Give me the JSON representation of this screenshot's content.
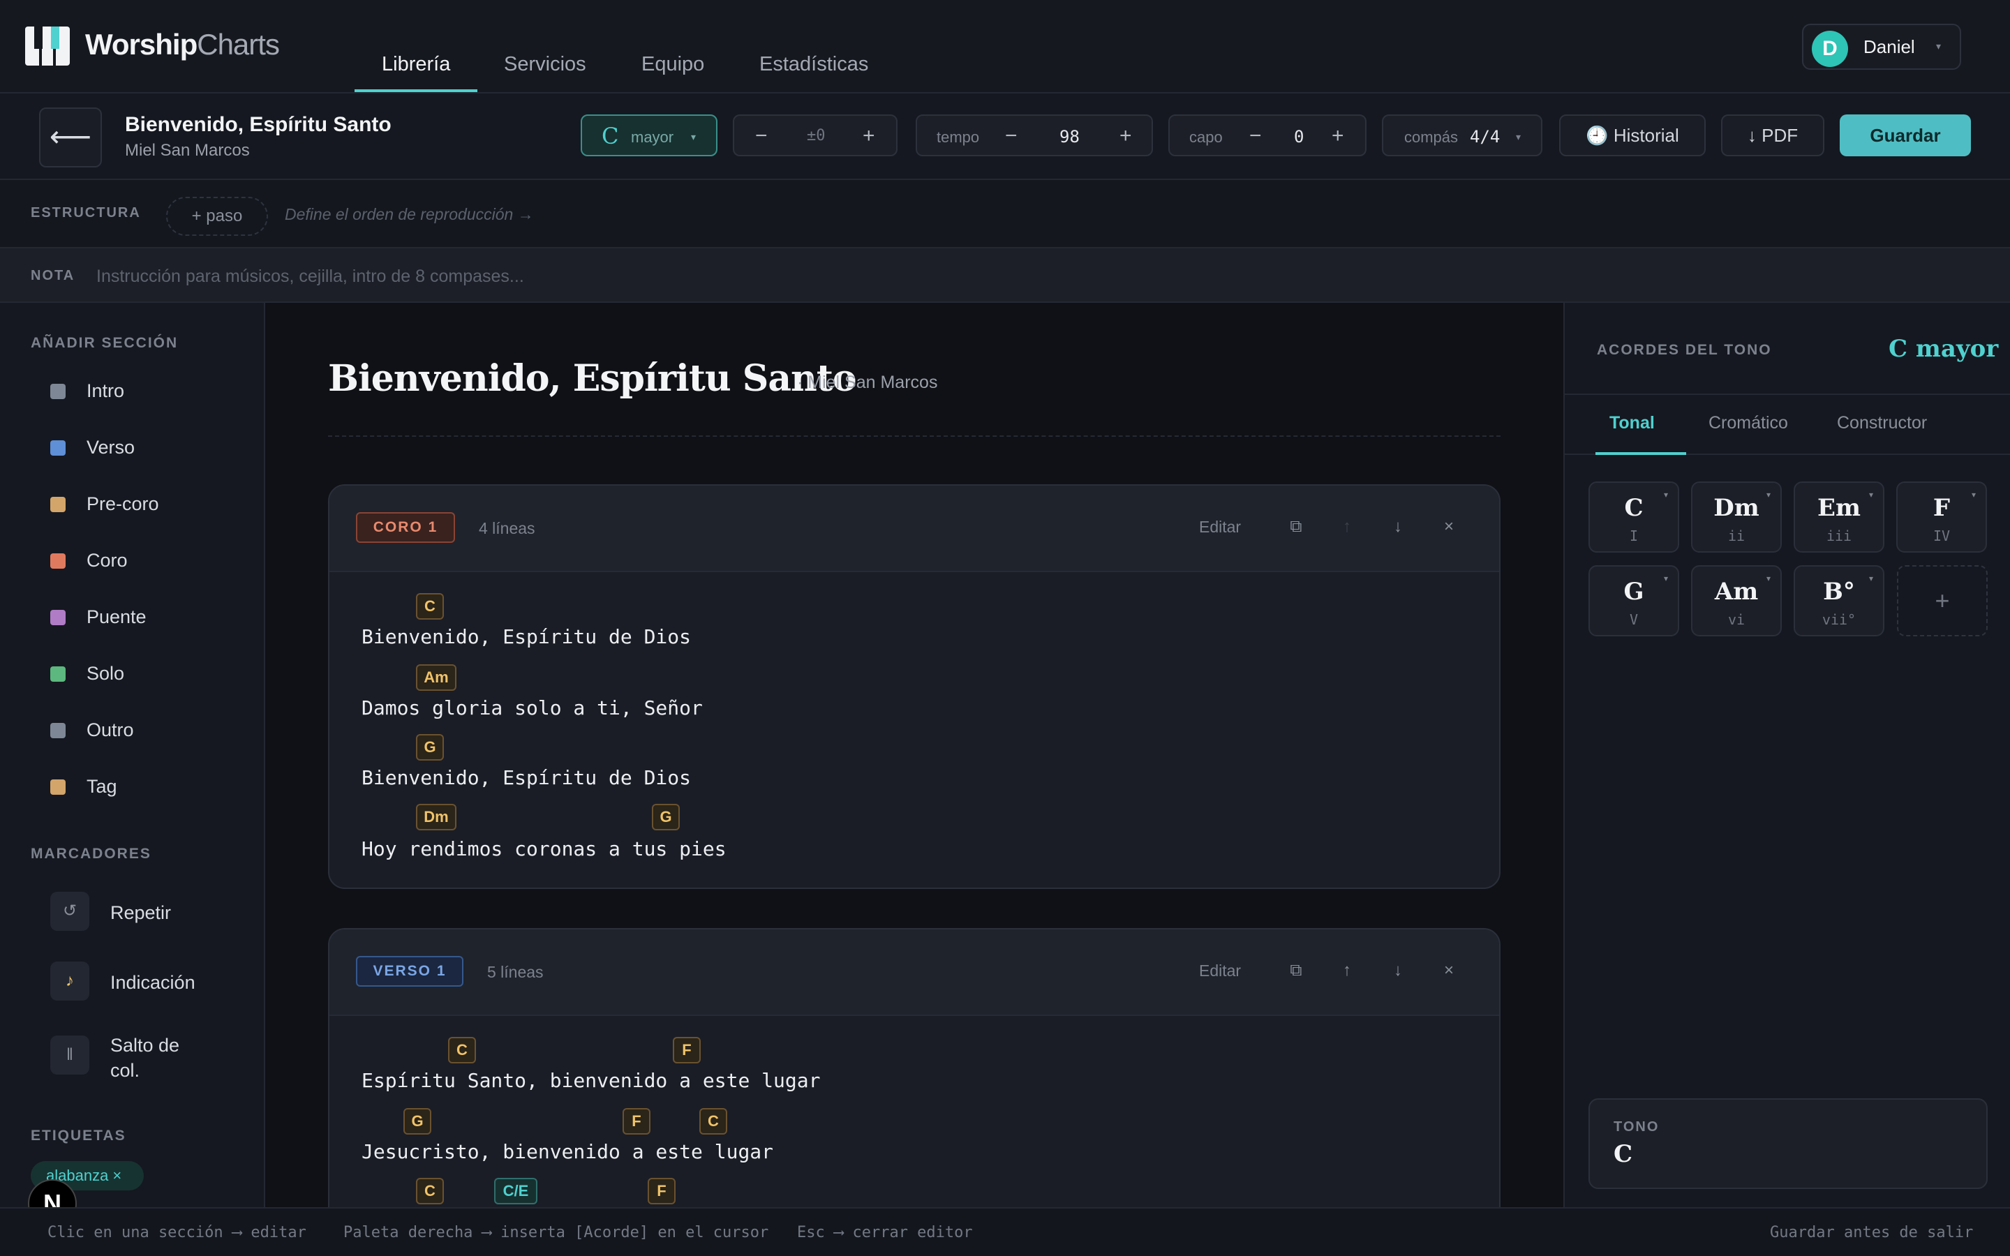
{
  "brand": {
    "name_bold": "Worship",
    "name_light": "Charts"
  },
  "nav": {
    "tabs": [
      "Librería",
      "Servicios",
      "Equipo",
      "Estadísticas"
    ],
    "active": "Librería"
  },
  "user": {
    "initial": "D",
    "name": "Daniel"
  },
  "song": {
    "title": "Bienvenido, Espíritu Santo",
    "artist": "Miel San Marcos"
  },
  "controls": {
    "key": {
      "letter": "C",
      "mode": "mayor"
    },
    "transpose": {
      "minus": "−",
      "value": "±0",
      "plus": "+"
    },
    "tempo": {
      "label": "tempo",
      "minus": "−",
      "value": "98",
      "plus": "+"
    },
    "capo": {
      "label": "capo",
      "minus": "−",
      "value": "0",
      "plus": "+"
    },
    "meter": {
      "label": "compás",
      "value": "4/4"
    },
    "history": "🕘 Historial",
    "pdf": "↓ PDF",
    "save": "Guardar"
  },
  "structure": {
    "label": "ESTRUCTURA",
    "add_step": "+ paso",
    "placeholder": "Define el orden de reproducción →"
  },
  "note": {
    "label": "NOTA",
    "placeholder": "Instrucción para músicos, cejilla, intro de 8 compases..."
  },
  "sidebar": {
    "add_section_title": "AÑADIR SECCIÓN",
    "sections": [
      {
        "label": "Intro",
        "color": "#7e8795"
      },
      {
        "label": "Verso",
        "color": "#5f8fd6"
      },
      {
        "label": "Pre-coro",
        "color": "#d3a56a"
      },
      {
        "label": "Coro",
        "color": "#e07a5f"
      },
      {
        "label": "Puente",
        "color": "#b07cc6"
      },
      {
        "label": "Solo",
        "color": "#5cb87e"
      },
      {
        "label": "Outro",
        "color": "#7e8795"
      },
      {
        "label": "Tag",
        "color": "#d3a56a"
      }
    ],
    "markers_title": "MARCADORES",
    "markers": [
      {
        "icon": "↺",
        "label": "Repetir"
      },
      {
        "icon": "♪",
        "label": "Indicación"
      },
      {
        "icon": "‖",
        "label": "Salto de col."
      }
    ],
    "tags_title": "ETIQUETAS",
    "tags": [
      {
        "label": "alabanza ×"
      }
    ]
  },
  "chart": {
    "title": "Bienvenido, Espíritu Santo",
    "artist": "· Miel San Marcos",
    "sections": [
      {
        "badge": "CORO 1",
        "lines_count": "4 líneas",
        "edit": "Editar",
        "lines": [
          {
            "chords": [
              "C"
            ],
            "lyric": "Bienvenido, Espíritu de Dios"
          },
          {
            "chords": [
              "Am"
            ],
            "lyric": "Damos gloria solo a ti, Señor"
          },
          {
            "chords": [
              "G"
            ],
            "lyric": "Bienvenido, Espíritu de Dios"
          },
          {
            "chords": [
              "Dm",
              "G"
            ],
            "lyric": "Hoy rendimos coronas a tus pies"
          }
        ]
      },
      {
        "badge": "VERSO 1",
        "lines_count": "5 líneas",
        "edit": "Editar",
        "lines": [
          {
            "chords": [
              "C",
              "F"
            ],
            "lyric": "Espíritu Santo, bienvenido a este lugar"
          },
          {
            "chords": [
              "G",
              "F",
              "C"
            ],
            "lyric": "Jesucristo, bienvenido a este lugar"
          },
          {
            "chords": [
              "C",
              "C/E",
              "F"
            ],
            "lyric": ""
          }
        ]
      }
    ]
  },
  "right_panel": {
    "title": "ACORDES DEL TONO",
    "key": "C mayor",
    "tabs": [
      "Tonal",
      "Cromático",
      "Constructor"
    ],
    "active_tab": "Tonal",
    "chords": [
      {
        "name": "C",
        "roman": "I"
      },
      {
        "name": "Dm",
        "roman": "ii"
      },
      {
        "name": "Em",
        "roman": "iii"
      },
      {
        "name": "F",
        "roman": "IV"
      },
      {
        "name": "G",
        "roman": "V"
      },
      {
        "name": "Am",
        "roman": "vi"
      },
      {
        "name": "B°",
        "roman": "vii°"
      }
    ],
    "add_chord": "+",
    "tono_label": "TONO",
    "tono_value": "C"
  },
  "footer": {
    "hints": [
      "Clic en una sección ⟶ editar",
      "Paleta derecha ⟶ inserta [Acorde] en el cursor",
      "Esc ⟶ cerrar editor"
    ],
    "right": "Guardar antes de salir"
  },
  "colors": {
    "accent": "#4fd1cf",
    "chord": "#f0c36a",
    "background": "#0f1116"
  }
}
